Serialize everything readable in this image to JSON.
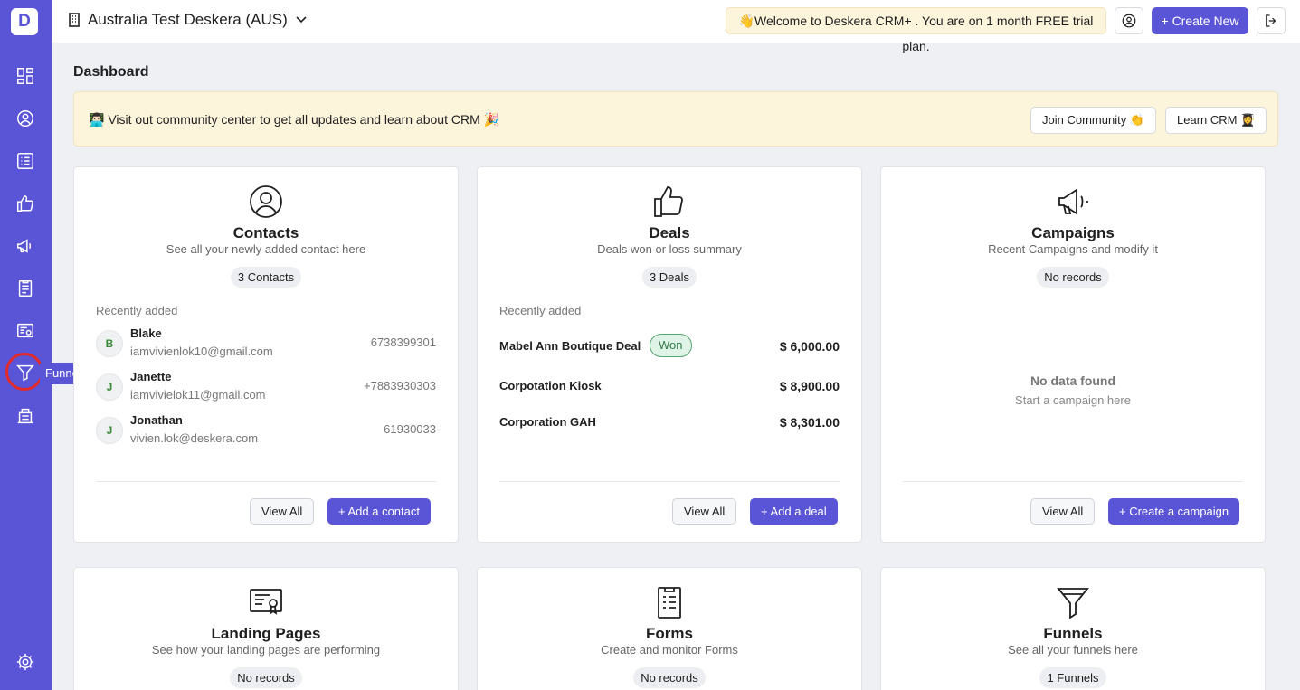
{
  "app": {
    "logo_letter": "D"
  },
  "sidebar": {
    "icons": [
      "dashboard-icon",
      "contacts-icon",
      "list-icon",
      "deals-icon",
      "campaigns-icon",
      "forms-icon",
      "landing-pages-icon",
      "funnels-icon",
      "tickets-icon",
      "settings-icon"
    ],
    "tooltip": "Funnels"
  },
  "header": {
    "org_name": "Australia Test Deskera (AUS)",
    "trial_message": "👋Welcome to Deskera CRM+ . You are on 1 month FREE trial plan.",
    "create_new_label": "+ Create New"
  },
  "page": {
    "title": "Dashboard"
  },
  "banner": {
    "text": "👨🏻‍💻 Visit out community center to get all updates and learn about CRM 🎉",
    "join_label": "Join Community 👏",
    "learn_label": "Learn CRM 👩‍🎓"
  },
  "contacts": {
    "title": "Contacts",
    "subtitle": "See all your newly added contact here",
    "count": "3 Contacts",
    "recent_label": "Recently added",
    "items": [
      {
        "initial": "B",
        "name": "Blake",
        "email": "iamvivienlok10@gmail.com",
        "phone": "6738399301"
      },
      {
        "initial": "J",
        "name": "Janette",
        "email": "iamvivielok11@gmail.com",
        "phone": "+7883930303"
      },
      {
        "initial": "J",
        "name": "Jonathan",
        "email": "vivien.lok@deskera.com",
        "phone": "61930033"
      }
    ],
    "view_all": "View All",
    "add_label": "+ Add a contact"
  },
  "deals": {
    "title": "Deals",
    "subtitle": "Deals won or loss summary",
    "count": "3 Deals",
    "recent_label": "Recently added",
    "items": [
      {
        "name": "Mabel Ann Boutique Deal",
        "status": "Won",
        "amount": "$ 6,000.00"
      },
      {
        "name": "Corpotation Kiosk",
        "amount": "$ 8,900.00"
      },
      {
        "name": "Corporation GAH",
        "amount": "$ 8,301.00"
      }
    ],
    "view_all": "View All",
    "add_label": "+ Add a deal"
  },
  "campaigns": {
    "title": "Campaigns",
    "subtitle": "Recent Campaigns and modify it",
    "count": "No records",
    "empty_title": "No data found",
    "empty_sub": "Start a campaign here",
    "view_all": "View All",
    "add_label": "+ Create a campaign"
  },
  "landing_pages": {
    "title": "Landing Pages",
    "subtitle": "See how your landing pages are performing",
    "count": "No records"
  },
  "forms": {
    "title": "Forms",
    "subtitle": "Create and monitor Forms",
    "count": "No records"
  },
  "funnels": {
    "title": "Funnels",
    "subtitle": "See all your funnels here",
    "count": "1 Funnels"
  },
  "colors": {
    "accent": "#5a55d6",
    "banner_bg": "#fdf4dc",
    "won_bg": "#dff3e6",
    "highlight": "#e22a2a"
  }
}
